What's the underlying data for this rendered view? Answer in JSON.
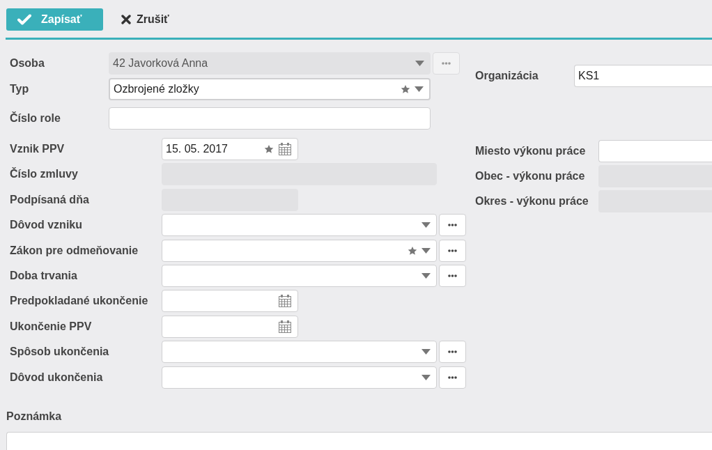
{
  "toolbar": {
    "buttons": [
      {
        "kind": "primary",
        "label": "Zapísať"
      },
      {
        "kind": "plain",
        "label": "Zrušiť"
      }
    ]
  },
  "left_groups": [
    {
      "fields": [
        {
          "label": "Osoba",
          "kind": "select",
          "value": "42 Javorková Anna",
          "disabled": true,
          "focused": false,
          "star": false,
          "more": true
        },
        {
          "label": "Typ",
          "kind": "select",
          "value": "Ozbrojené zložky",
          "disabled": false,
          "focused": true,
          "star": true,
          "more": false
        },
        {
          "label": "Číslo role",
          "kind": "text",
          "disabled": false,
          "focused": false
        }
      ]
    },
    {
      "fields": [
        {
          "label": "Vznik PPV",
          "kind": "date",
          "value": "15. 05. 2017",
          "disabled": false,
          "focused": false,
          "star": true
        },
        {
          "label": "Číslo zmluvy",
          "kind": "text",
          "disabled": true,
          "focused": false
        },
        {
          "label": "Podpísaná dňa",
          "kind": "date",
          "disabled": true,
          "focused": false,
          "star": false
        },
        {
          "label": "Dôvod vzniku",
          "kind": "select",
          "disabled": false,
          "focused": false,
          "star": false,
          "more": true
        },
        {
          "label": "Zákon pre odmeňovanie",
          "kind": "select",
          "disabled": false,
          "focused": false,
          "star": true,
          "more": true
        },
        {
          "label": "Doba trvania",
          "kind": "select",
          "disabled": false,
          "focused": false,
          "star": false,
          "more": true
        },
        {
          "label": "Predpokladané ukončenie",
          "kind": "date",
          "disabled": false,
          "focused": false,
          "star": false
        },
        {
          "label": "Ukončenie PPV",
          "kind": "date",
          "disabled": false,
          "focused": false,
          "star": false
        },
        {
          "label": "Spôsob ukončenia",
          "kind": "select",
          "disabled": false,
          "focused": false,
          "star": false,
          "more": true
        },
        {
          "label": "Dôvod ukončenia",
          "kind": "select",
          "disabled": false,
          "focused": false,
          "star": false,
          "more": true
        }
      ]
    }
  ],
  "right_groups": [
    {
      "fields": [
        {
          "label": "Organizácia",
          "kind": "text",
          "value": "KS1",
          "disabled": false,
          "focused": false
        }
      ]
    },
    {
      "fields": [
        {
          "label": "Miesto výkonu práce",
          "kind": "text",
          "disabled": false,
          "focused": false
        },
        {
          "label": "Obec - výkonu práce",
          "kind": "text",
          "disabled": true,
          "focused": false
        },
        {
          "label": "Okres - výkonu práce",
          "kind": "text",
          "disabled": true,
          "focused": false
        }
      ]
    }
  ],
  "note": {
    "label": "Poznámka"
  }
}
